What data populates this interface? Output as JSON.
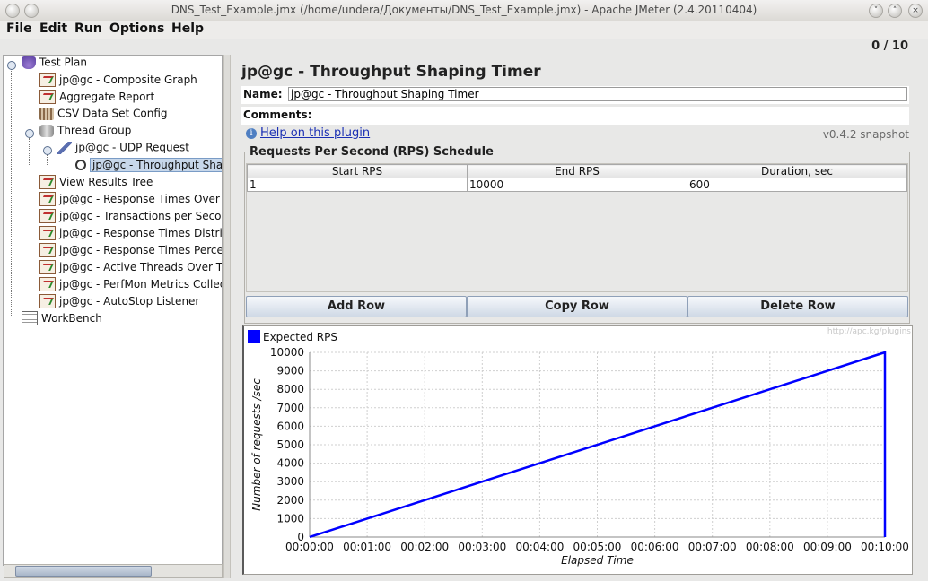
{
  "window": {
    "title": "DNS_Test_Example.jmx (/home/undera/Документы/DNS_Test_Example.jmx) - Apache JMeter (2.4.20110404)"
  },
  "menu": [
    "File",
    "Edit",
    "Run",
    "Options",
    "Help"
  ],
  "toolbar": {
    "counter": "0 / 10"
  },
  "tree": {
    "items": [
      {
        "label": "Test Plan"
      },
      {
        "label": "jp@gc - Composite Graph"
      },
      {
        "label": "Aggregate Report"
      },
      {
        "label": "CSV Data Set Config"
      },
      {
        "label": "Thread Group"
      },
      {
        "label": "jp@gc - UDP Request"
      },
      {
        "label": "jp@gc - Throughput Shaping Timer"
      },
      {
        "label": "View Results Tree"
      },
      {
        "label": "jp@gc - Response Times Over Time"
      },
      {
        "label": "jp@gc - Transactions per Second"
      },
      {
        "label": "jp@gc - Response Times Distribution"
      },
      {
        "label": "jp@gc - Response Times Percentiles"
      },
      {
        "label": "jp@gc - Active Threads Over Time"
      },
      {
        "label": "jp@gc - PerfMon Metrics Collector"
      },
      {
        "label": "jp@gc - AutoStop Listener"
      },
      {
        "label": "WorkBench"
      }
    ]
  },
  "panel": {
    "title": "jp@gc - Throughput Shaping Timer",
    "name_label": "Name:",
    "name_value": "jp@gc - Throughput Shaping Timer",
    "comments_label": "Comments:",
    "help_link": "Help on this plugin",
    "version": "v0.4.2 snapshot"
  },
  "schedule": {
    "title": "Requests Per Second (RPS) Schedule",
    "columns": [
      "Start RPS",
      "End RPS",
      "Duration, sec"
    ],
    "rows": [
      [
        "1",
        "10000",
        "600"
      ]
    ],
    "buttons": {
      "add": "Add Row",
      "copy": "Copy Row",
      "delete": "Delete Row"
    }
  },
  "chart_data": {
    "type": "line",
    "watermark": "http://apc.kg/plugins",
    "xlabel": "Elapsed Time",
    "ylabel": "Number of requests /sec",
    "ylim": [
      0,
      10000
    ],
    "yticks": [
      0,
      1000,
      2000,
      3000,
      4000,
      5000,
      6000,
      7000,
      8000,
      9000,
      10000
    ],
    "xlim": [
      0,
      600
    ],
    "xticks": [
      "00:00:00",
      "00:01:00",
      "00:02:00",
      "00:03:00",
      "00:04:00",
      "00:05:00",
      "00:06:00",
      "00:07:00",
      "00:08:00",
      "00:09:00",
      "00:10:00"
    ],
    "grid": true,
    "legend": "top-left",
    "series": [
      {
        "name": "Expected RPS",
        "color": "#0000ff",
        "x": [
          0,
          600,
          600
        ],
        "y": [
          1,
          10000,
          0
        ]
      }
    ]
  }
}
